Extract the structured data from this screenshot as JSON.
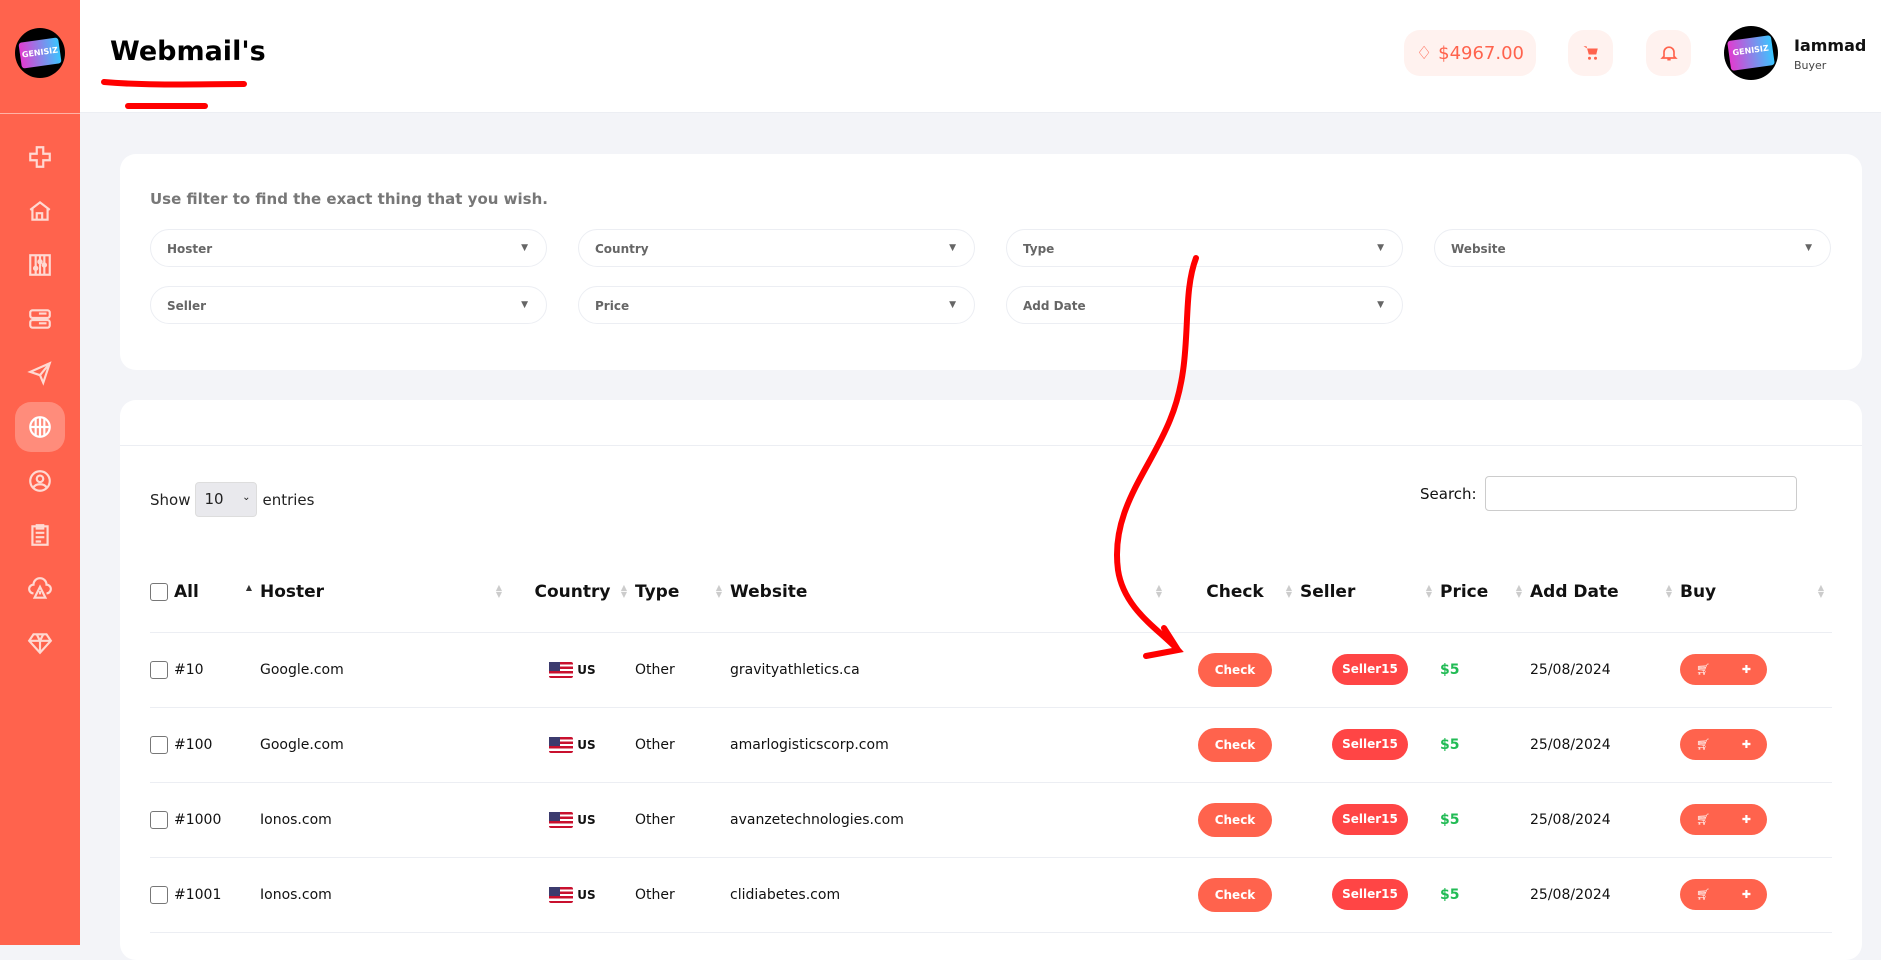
{
  "header": {
    "title": "Webmail's",
    "balance": "$4967.00",
    "user_name": "Iammad",
    "user_role": "Buyer",
    "logo_text": "GENISIZ"
  },
  "sidebar": {
    "items": [
      "add",
      "home",
      "settings",
      "servers",
      "send",
      "webmail",
      "profile",
      "orders",
      "alerts",
      "premium"
    ],
    "active": "webmail"
  },
  "filter": {
    "hint": "Use filter to find the exact thing that you wish.",
    "selects": [
      "Hoster",
      "Country",
      "Type",
      "Website",
      "Seller",
      "Price",
      "Add Date"
    ]
  },
  "table_controls": {
    "show": "Show",
    "entries_value": "10",
    "entries": "entries",
    "search_label": "Search:",
    "search_value": ""
  },
  "columns": [
    "All",
    "Hoster",
    "Country",
    "Type",
    "Website",
    "Check",
    "Seller",
    "Price",
    "Add Date",
    "Buy"
  ],
  "rows": [
    {
      "id": "#10",
      "hoster": "Google.com",
      "country": "US",
      "type": "Other",
      "website": "gravityathletics.ca",
      "check": "Check",
      "seller": "Seller15",
      "price": "$5",
      "date": "25/08/2024"
    },
    {
      "id": "#100",
      "hoster": "Google.com",
      "country": "US",
      "type": "Other",
      "website": "amarlogisticscorp.com",
      "check": "Check",
      "seller": "Seller15",
      "price": "$5",
      "date": "25/08/2024"
    },
    {
      "id": "#1000",
      "hoster": "Ionos.com",
      "country": "US",
      "type": "Other",
      "website": "avanzetechnologies.com",
      "check": "Check",
      "seller": "Seller15",
      "price": "$5",
      "date": "25/08/2024"
    },
    {
      "id": "#1001",
      "hoster": "Ionos.com",
      "country": "US",
      "type": "Other",
      "website": "clidiabetes.com",
      "check": "Check",
      "seller": "Seller15",
      "price": "$5",
      "date": "25/08/2024"
    }
  ],
  "colors": {
    "accent": "#ff634d",
    "seller": "#ff4545",
    "price": "#22bb55"
  }
}
